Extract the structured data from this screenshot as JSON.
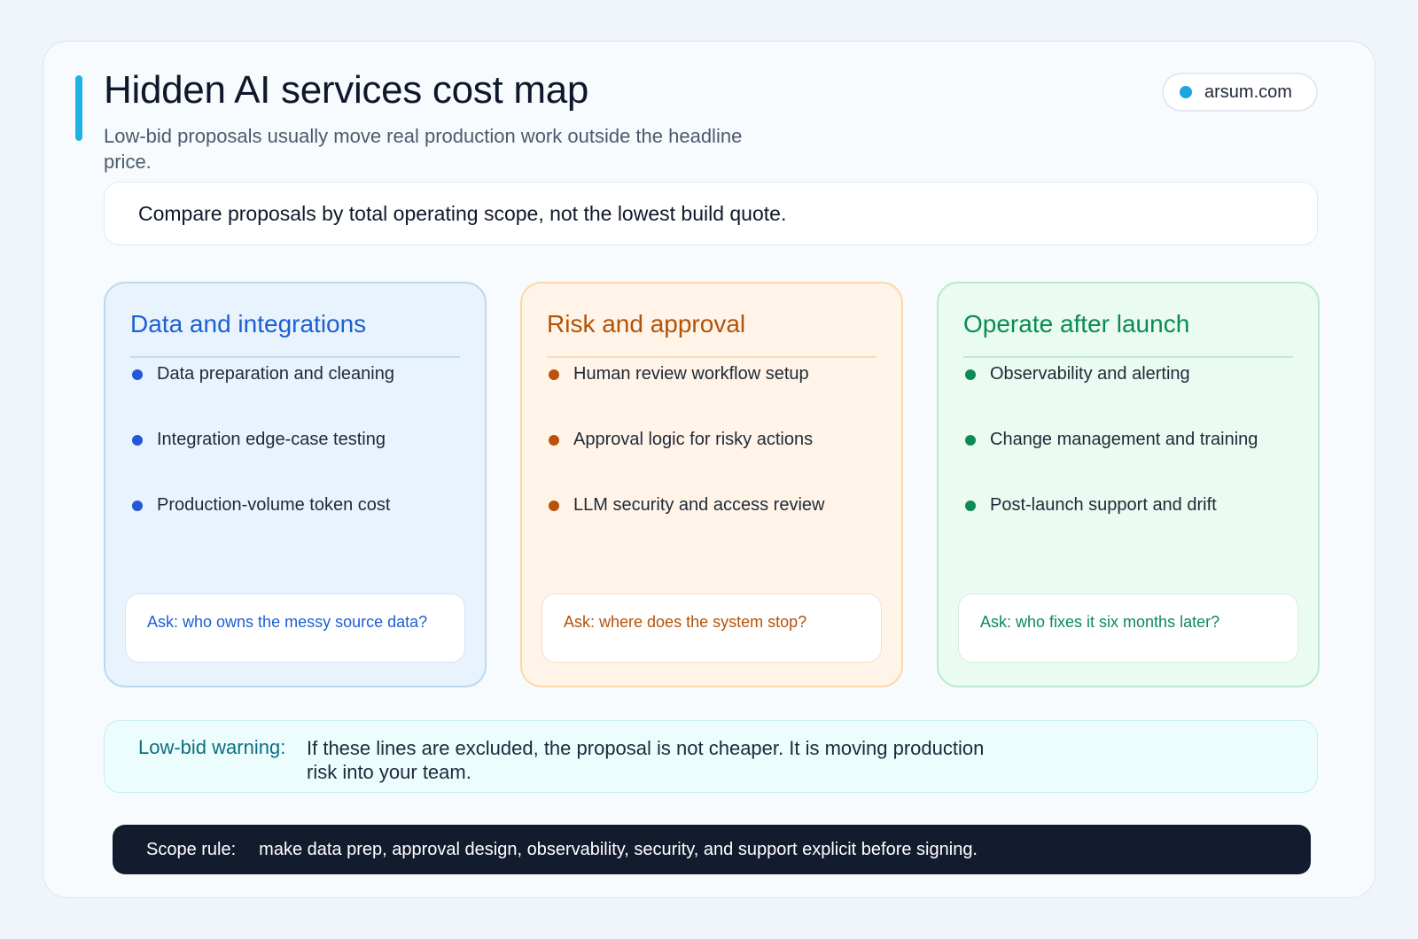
{
  "header": {
    "title": "Hidden AI services cost map",
    "subtitle": "Low-bid proposals usually move real production work outside the headline price.",
    "brand": "arsum.com",
    "accent_color": "#1fb2e5"
  },
  "banner": {
    "text": "Compare proposals by total operating scope, not the lowest build quote."
  },
  "columns": [
    {
      "title": "Data and integrations",
      "color": "#1d5fd3",
      "items": [
        "Data preparation and cleaning",
        "Integration edge-case testing",
        "Production-volume token cost"
      ],
      "ask": "Ask: who owns the messy source data?"
    },
    {
      "title": "Risk and approval",
      "color": "#b45209",
      "items": [
        "Human review workflow setup",
        "Approval logic for risky actions",
        "LLM security and access review"
      ],
      "ask": "Ask: where does the system stop?"
    },
    {
      "title": "Operate after launch",
      "color": "#0c8a55",
      "items": [
        "Observability and alerting",
        "Change management and training",
        "Post-launch support and drift"
      ],
      "ask": "Ask: who fixes it six months later?"
    }
  ],
  "warning": {
    "label": "Low-bid warning:",
    "text": "If these lines are excluded, the proposal is not cheaper. It is moving production risk into your team."
  },
  "scope_rule": {
    "label": "Scope rule:",
    "text": "make data prep, approval design, observability, security, and support explicit before signing."
  }
}
